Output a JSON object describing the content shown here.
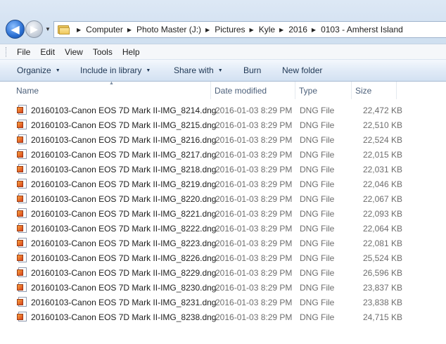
{
  "navigation": {
    "back_glyph": "◀",
    "forward_glyph": "▶",
    "recent_glyph": "▼"
  },
  "address": {
    "separator": "▶",
    "crumbs": [
      "Computer",
      "Photo Master (J:)",
      "Pictures",
      "Kyle",
      "2016",
      "0103 - Amherst Island"
    ]
  },
  "menu": [
    "File",
    "Edit",
    "View",
    "Tools",
    "Help"
  ],
  "commands": {
    "organize": "Organize",
    "include_in_library": "Include in library",
    "share_with": "Share with",
    "burn": "Burn",
    "new_folder": "New folder",
    "caret": "▼"
  },
  "columns": {
    "name": "Name",
    "date_modified": "Date modified",
    "type": "Type",
    "size": "Size",
    "sort_glyph": "▲"
  },
  "files": [
    {
      "name": "20160103-Canon EOS 7D Mark II-IMG_8214.dng",
      "date": "2016-01-03 8:29 PM",
      "type": "DNG File",
      "size": "22,472 KB"
    },
    {
      "name": "20160103-Canon EOS 7D Mark II-IMG_8215.dng",
      "date": "2016-01-03 8:29 PM",
      "type": "DNG File",
      "size": "22,510 KB"
    },
    {
      "name": "20160103-Canon EOS 7D Mark II-IMG_8216.dng",
      "date": "2016-01-03 8:29 PM",
      "type": "DNG File",
      "size": "22,524 KB"
    },
    {
      "name": "20160103-Canon EOS 7D Mark II-IMG_8217.dng",
      "date": "2016-01-03 8:29 PM",
      "type": "DNG File",
      "size": "22,015 KB"
    },
    {
      "name": "20160103-Canon EOS 7D Mark II-IMG_8218.dng",
      "date": "2016-01-03 8:29 PM",
      "type": "DNG File",
      "size": "22,031 KB"
    },
    {
      "name": "20160103-Canon EOS 7D Mark II-IMG_8219.dng",
      "date": "2016-01-03 8:29 PM",
      "type": "DNG File",
      "size": "22,046 KB"
    },
    {
      "name": "20160103-Canon EOS 7D Mark II-IMG_8220.dng",
      "date": "2016-01-03 8:29 PM",
      "type": "DNG File",
      "size": "22,067 KB"
    },
    {
      "name": "20160103-Canon EOS 7D Mark II-IMG_8221.dng",
      "date": "2016-01-03 8:29 PM",
      "type": "DNG File",
      "size": "22,093 KB"
    },
    {
      "name": "20160103-Canon EOS 7D Mark II-IMG_8222.dng",
      "date": "2016-01-03 8:29 PM",
      "type": "DNG File",
      "size": "22,064 KB"
    },
    {
      "name": "20160103-Canon EOS 7D Mark II-IMG_8223.dng",
      "date": "2016-01-03 8:29 PM",
      "type": "DNG File",
      "size": "22,081 KB"
    },
    {
      "name": "20160103-Canon EOS 7D Mark II-IMG_8226.dng",
      "date": "2016-01-03 8:29 PM",
      "type": "DNG File",
      "size": "25,524 KB"
    },
    {
      "name": "20160103-Canon EOS 7D Mark II-IMG_8229.dng",
      "date": "2016-01-03 8:29 PM",
      "type": "DNG File",
      "size": "26,596 KB"
    },
    {
      "name": "20160103-Canon EOS 7D Mark II-IMG_8230.dng",
      "date": "2016-01-03 8:29 PM",
      "type": "DNG File",
      "size": "23,837 KB"
    },
    {
      "name": "20160103-Canon EOS 7D Mark II-IMG_8231.dng",
      "date": "2016-01-03 8:29 PM",
      "type": "DNG File",
      "size": "23,838 KB"
    },
    {
      "name": "20160103-Canon EOS 7D Mark II-IMG_8238.dng",
      "date": "2016-01-03 8:29 PM",
      "type": "DNG File",
      "size": "24,715 KB"
    }
  ]
}
